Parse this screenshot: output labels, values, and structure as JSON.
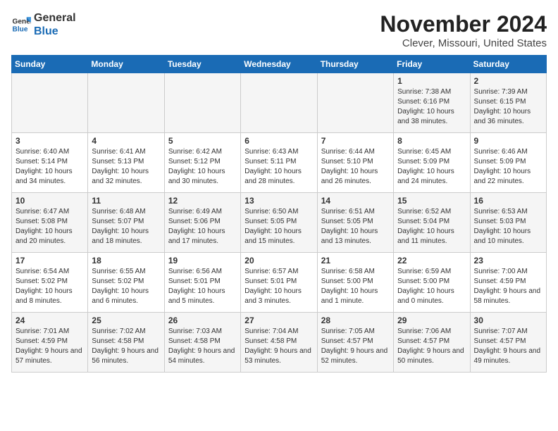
{
  "logo": {
    "line1": "General",
    "line2": "Blue"
  },
  "title": "November 2024",
  "subtitle": "Clever, Missouri, United States",
  "days_of_week": [
    "Sunday",
    "Monday",
    "Tuesday",
    "Wednesday",
    "Thursday",
    "Friday",
    "Saturday"
  ],
  "weeks": [
    [
      {
        "day": "",
        "text": ""
      },
      {
        "day": "",
        "text": ""
      },
      {
        "day": "",
        "text": ""
      },
      {
        "day": "",
        "text": ""
      },
      {
        "day": "",
        "text": ""
      },
      {
        "day": "1",
        "text": "Sunrise: 7:38 AM\nSunset: 6:16 PM\nDaylight: 10 hours and 38 minutes."
      },
      {
        "day": "2",
        "text": "Sunrise: 7:39 AM\nSunset: 6:15 PM\nDaylight: 10 hours and 36 minutes."
      }
    ],
    [
      {
        "day": "3",
        "text": "Sunrise: 6:40 AM\nSunset: 5:14 PM\nDaylight: 10 hours and 34 minutes."
      },
      {
        "day": "4",
        "text": "Sunrise: 6:41 AM\nSunset: 5:13 PM\nDaylight: 10 hours and 32 minutes."
      },
      {
        "day": "5",
        "text": "Sunrise: 6:42 AM\nSunset: 5:12 PM\nDaylight: 10 hours and 30 minutes."
      },
      {
        "day": "6",
        "text": "Sunrise: 6:43 AM\nSunset: 5:11 PM\nDaylight: 10 hours and 28 minutes."
      },
      {
        "day": "7",
        "text": "Sunrise: 6:44 AM\nSunset: 5:10 PM\nDaylight: 10 hours and 26 minutes."
      },
      {
        "day": "8",
        "text": "Sunrise: 6:45 AM\nSunset: 5:09 PM\nDaylight: 10 hours and 24 minutes."
      },
      {
        "day": "9",
        "text": "Sunrise: 6:46 AM\nSunset: 5:09 PM\nDaylight: 10 hours and 22 minutes."
      }
    ],
    [
      {
        "day": "10",
        "text": "Sunrise: 6:47 AM\nSunset: 5:08 PM\nDaylight: 10 hours and 20 minutes."
      },
      {
        "day": "11",
        "text": "Sunrise: 6:48 AM\nSunset: 5:07 PM\nDaylight: 10 hours and 18 minutes."
      },
      {
        "day": "12",
        "text": "Sunrise: 6:49 AM\nSunset: 5:06 PM\nDaylight: 10 hours and 17 minutes."
      },
      {
        "day": "13",
        "text": "Sunrise: 6:50 AM\nSunset: 5:05 PM\nDaylight: 10 hours and 15 minutes."
      },
      {
        "day": "14",
        "text": "Sunrise: 6:51 AM\nSunset: 5:05 PM\nDaylight: 10 hours and 13 minutes."
      },
      {
        "day": "15",
        "text": "Sunrise: 6:52 AM\nSunset: 5:04 PM\nDaylight: 10 hours and 11 minutes."
      },
      {
        "day": "16",
        "text": "Sunrise: 6:53 AM\nSunset: 5:03 PM\nDaylight: 10 hours and 10 minutes."
      }
    ],
    [
      {
        "day": "17",
        "text": "Sunrise: 6:54 AM\nSunset: 5:02 PM\nDaylight: 10 hours and 8 minutes."
      },
      {
        "day": "18",
        "text": "Sunrise: 6:55 AM\nSunset: 5:02 PM\nDaylight: 10 hours and 6 minutes."
      },
      {
        "day": "19",
        "text": "Sunrise: 6:56 AM\nSunset: 5:01 PM\nDaylight: 10 hours and 5 minutes."
      },
      {
        "day": "20",
        "text": "Sunrise: 6:57 AM\nSunset: 5:01 PM\nDaylight: 10 hours and 3 minutes."
      },
      {
        "day": "21",
        "text": "Sunrise: 6:58 AM\nSunset: 5:00 PM\nDaylight: 10 hours and 1 minute."
      },
      {
        "day": "22",
        "text": "Sunrise: 6:59 AM\nSunset: 5:00 PM\nDaylight: 10 hours and 0 minutes."
      },
      {
        "day": "23",
        "text": "Sunrise: 7:00 AM\nSunset: 4:59 PM\nDaylight: 9 hours and 58 minutes."
      }
    ],
    [
      {
        "day": "24",
        "text": "Sunrise: 7:01 AM\nSunset: 4:59 PM\nDaylight: 9 hours and 57 minutes."
      },
      {
        "day": "25",
        "text": "Sunrise: 7:02 AM\nSunset: 4:58 PM\nDaylight: 9 hours and 56 minutes."
      },
      {
        "day": "26",
        "text": "Sunrise: 7:03 AM\nSunset: 4:58 PM\nDaylight: 9 hours and 54 minutes."
      },
      {
        "day": "27",
        "text": "Sunrise: 7:04 AM\nSunset: 4:58 PM\nDaylight: 9 hours and 53 minutes."
      },
      {
        "day": "28",
        "text": "Sunrise: 7:05 AM\nSunset: 4:57 PM\nDaylight: 9 hours and 52 minutes."
      },
      {
        "day": "29",
        "text": "Sunrise: 7:06 AM\nSunset: 4:57 PM\nDaylight: 9 hours and 50 minutes."
      },
      {
        "day": "30",
        "text": "Sunrise: 7:07 AM\nSunset: 4:57 PM\nDaylight: 9 hours and 49 minutes."
      }
    ]
  ]
}
